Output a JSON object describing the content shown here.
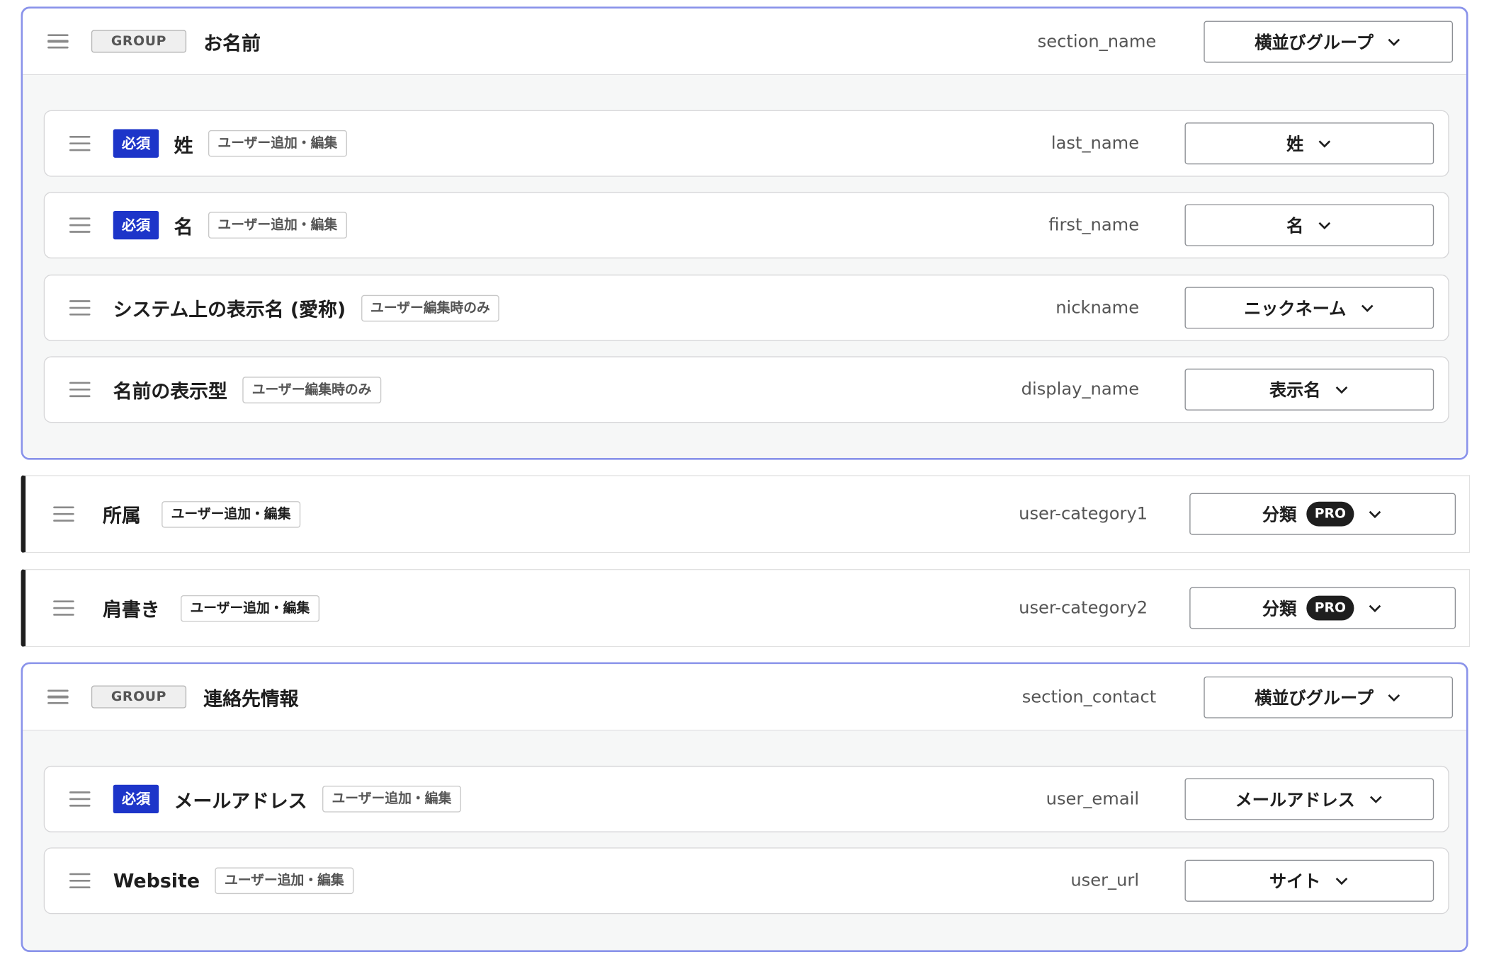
{
  "icons": {
    "drag": "drag-handle-icon",
    "chevron": "chevron-down-icon"
  },
  "colors": {
    "group_border": "#8a93ea",
    "required_badge": "#1d35c9",
    "pro_badge": "#1e1e1e",
    "standalone_accent": "#1e1e1e"
  },
  "groups": [
    {
      "badge": "GROUP",
      "title": "お名前",
      "key": "section_name",
      "select": "横並びグループ",
      "fields": [
        {
          "required": "必須",
          "title": "姓",
          "tag": "ユーザー追加・編集",
          "key": "last_name",
          "select": "姓"
        },
        {
          "required": "必須",
          "title": "名",
          "tag": "ユーザー追加・編集",
          "key": "first_name",
          "select": "名"
        },
        {
          "title": "システム上の表示名 (愛称)",
          "tag": "ユーザー編集時のみ",
          "key": "nickname",
          "select": "ニックネーム"
        },
        {
          "title": "名前の表示型",
          "tag": "ユーザー編集時のみ",
          "key": "display_name",
          "select": "表示名"
        }
      ]
    },
    {
      "badge": "GROUP",
      "title": "連絡先情報",
      "key": "section_contact",
      "select": "横並びグループ",
      "fields": [
        {
          "required": "必須",
          "title": "メールアドレス",
          "tag": "ユーザー追加・編集",
          "key": "user_email",
          "select": "メールアドレス"
        },
        {
          "title": "Website",
          "tag": "ユーザー追加・編集",
          "key": "user_url",
          "select": "サイト"
        }
      ]
    }
  ],
  "standalone": [
    {
      "title": "所属",
      "tag": "ユーザー追加・編集",
      "key": "user-category1",
      "select": "分類",
      "pro": "PRO"
    },
    {
      "title": "肩書き",
      "tag": "ユーザー追加・編集",
      "key": "user-category2",
      "select": "分類",
      "pro": "PRO"
    }
  ]
}
